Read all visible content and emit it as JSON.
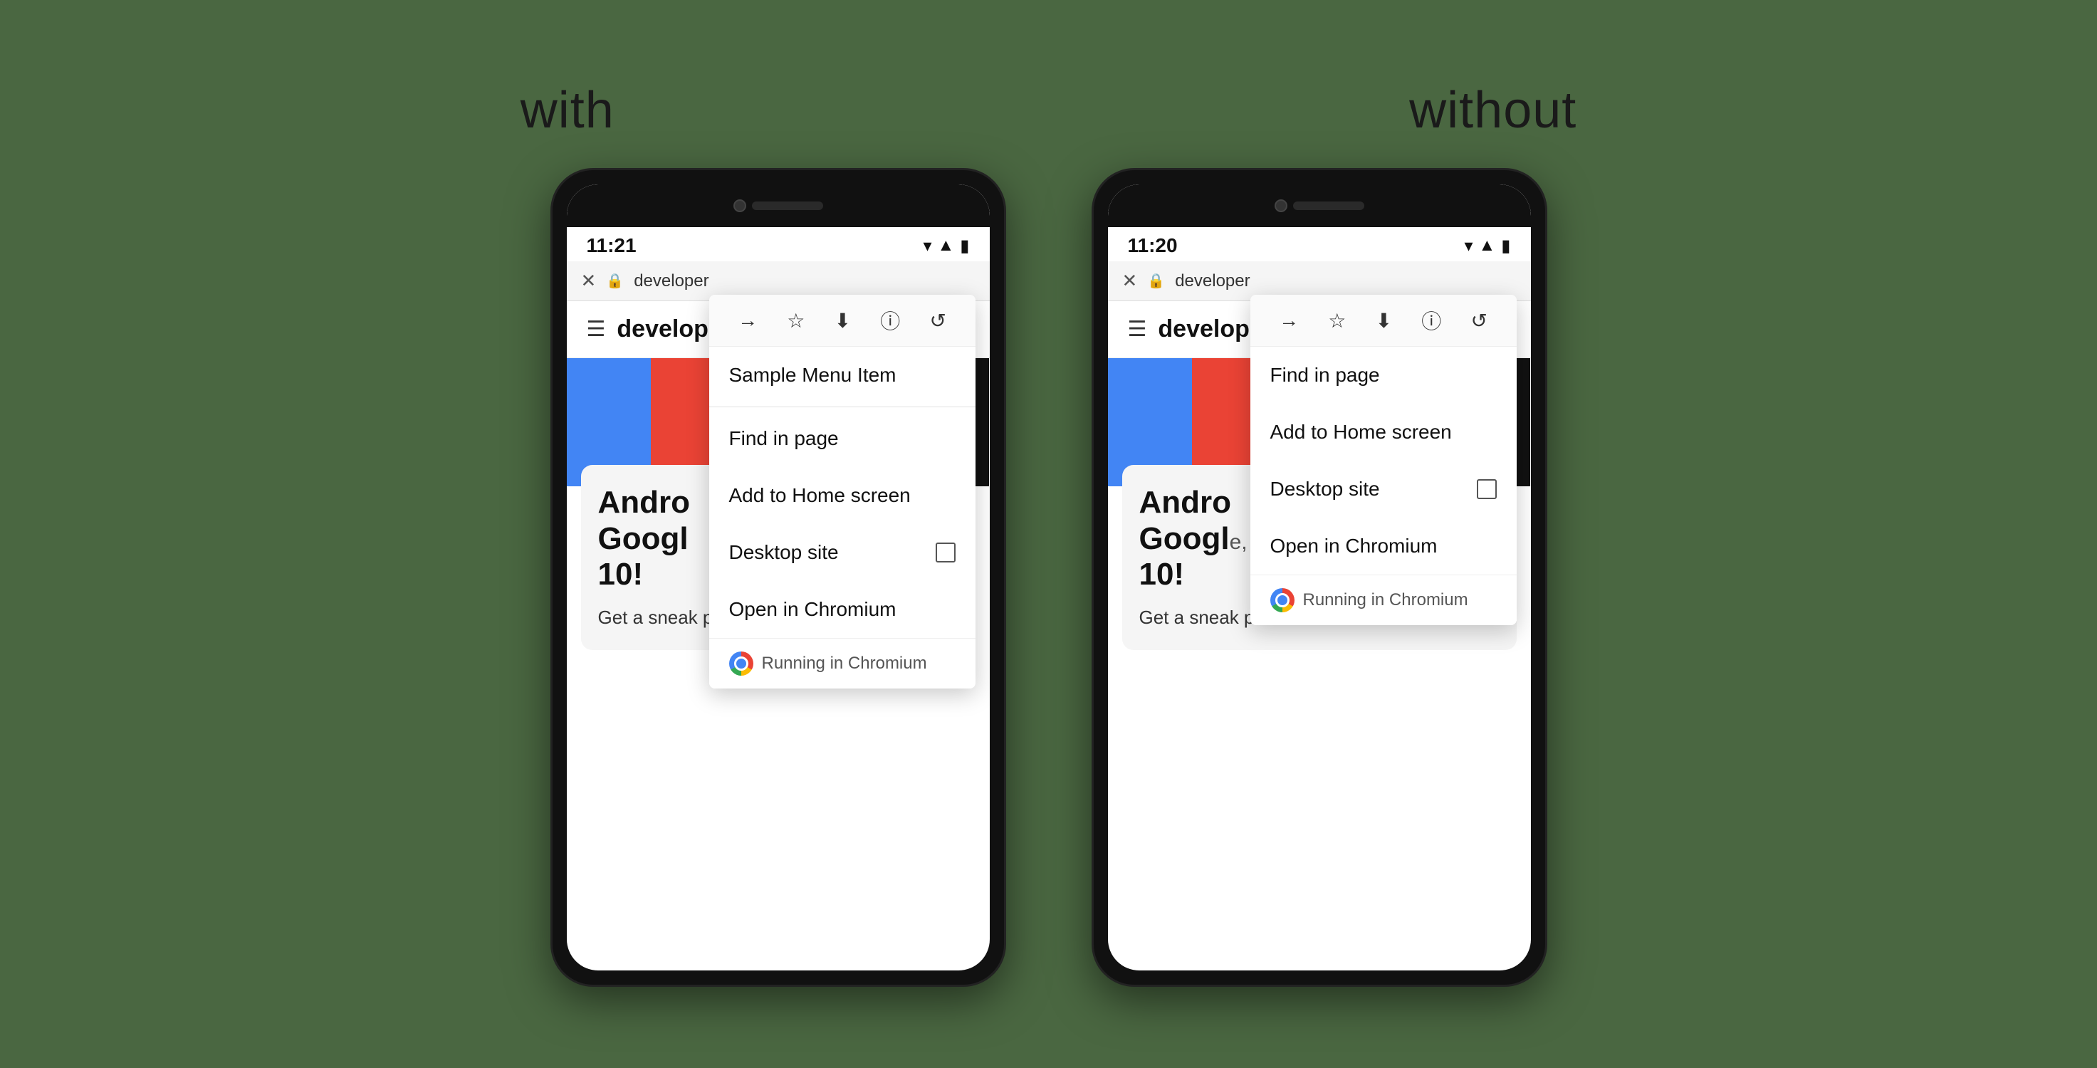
{
  "background_color": "#4a6741",
  "labels": {
    "with": "with",
    "without": "without"
  },
  "phone_with": {
    "time": "11:21",
    "url": "developer",
    "page_title": "develop",
    "dropdown": {
      "toolbar_items": [
        "→",
        "☆",
        "⬇",
        "ⓘ",
        "↺"
      ],
      "menu_items": [
        {
          "label": "Sample Menu Item",
          "has_checkbox": false,
          "is_divider_after": true
        },
        {
          "label": "Find in page",
          "has_checkbox": false
        },
        {
          "label": "Add to Home screen",
          "has_checkbox": false
        },
        {
          "label": "Desktop site",
          "has_checkbox": true
        },
        {
          "label": "Open in Chromium",
          "has_checkbox": false
        }
      ],
      "running_badge": "Running in Chromium"
    }
  },
  "phone_without": {
    "time": "11:20",
    "url": "developer",
    "page_title": "develop",
    "dropdown": {
      "toolbar_items": [
        "→",
        "☆",
        "⬇",
        "ⓘ",
        "↺"
      ],
      "menu_items": [
        {
          "label": "Find in page",
          "has_checkbox": false
        },
        {
          "label": "Add to Home screen",
          "has_checkbox": false
        },
        {
          "label": "Desktop site",
          "has_checkbox": true
        },
        {
          "label": "Open in Chromium",
          "has_checkbox": false
        }
      ],
      "running_badge": "Running in Chromium"
    }
  },
  "android_content": {
    "title_line1": "Andro",
    "title_line2": "Googl",
    "title_line3": "10!",
    "subtitle": "Get a sneak peek of the Android talks that"
  },
  "icons": {
    "wifi": "▼",
    "signal": "▲",
    "battery": "▮",
    "close": "✕",
    "lock": "🔒",
    "hamburger": "☰",
    "arrow": "→",
    "star": "☆",
    "download": "⬇",
    "info": "ⓘ",
    "refresh": "↺"
  }
}
